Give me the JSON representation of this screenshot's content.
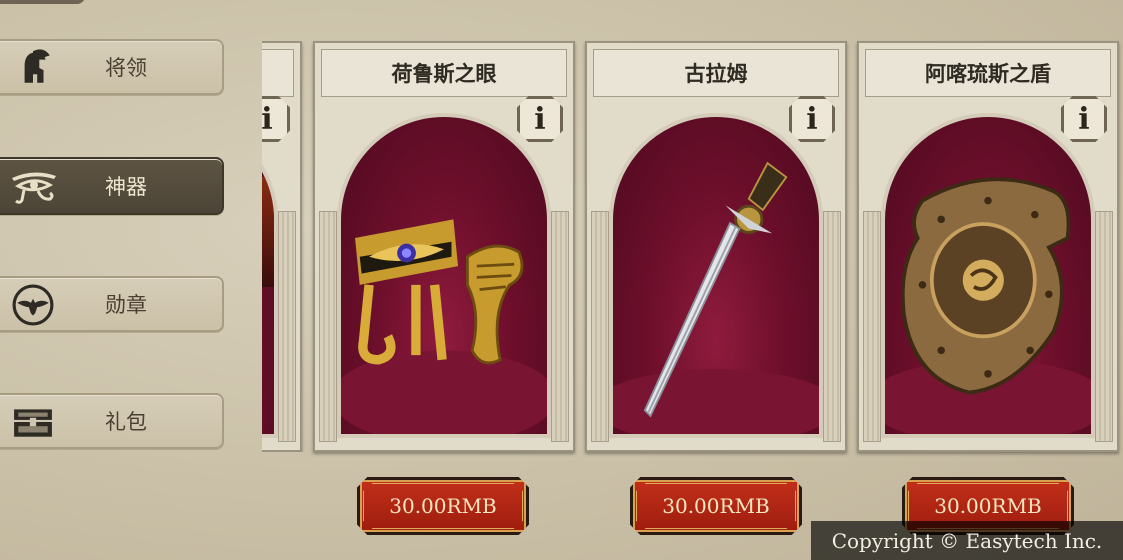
{
  "sidebar": {
    "items": [
      {
        "label": "将领",
        "icon": "spartan-helmet-icon",
        "active": false
      },
      {
        "label": "神器",
        "icon": "eye-of-horus-icon",
        "active": true
      },
      {
        "label": "勋章",
        "icon": "eagle-medal-icon",
        "active": false
      },
      {
        "label": "礼包",
        "icon": "treasure-chest-icon",
        "active": false
      }
    ]
  },
  "cards": [
    {
      "title": "",
      "info": "i",
      "item": "partial-artifact-image"
    },
    {
      "title": "荷鲁斯之眼",
      "info": "i",
      "item": "eye-of-horus-bracelet-image",
      "price": "30.00RMB"
    },
    {
      "title": "古拉姆",
      "info": "i",
      "item": "sword-image",
      "price": "30.00RMB"
    },
    {
      "title": "阿喀琉斯之盾",
      "info": "i",
      "item": "shield-image",
      "price": "30.00RMB"
    }
  ],
  "footer": {
    "copyright": "Copyright © Easytech Inc."
  },
  "colors": {
    "active_tab": "#4c4436",
    "price_button": "#b3250f",
    "arch_background": "#6e0f2c"
  }
}
